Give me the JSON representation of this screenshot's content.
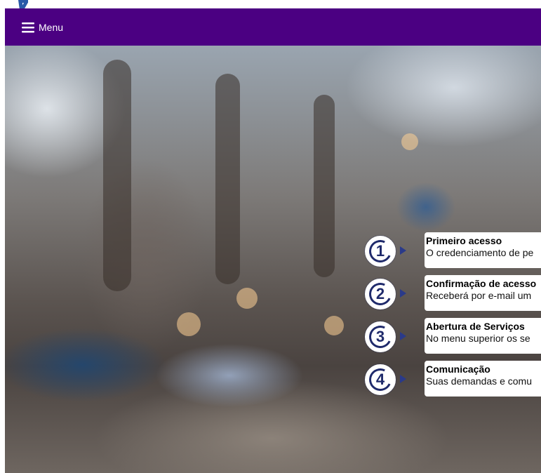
{
  "header": {
    "menu_label": "Menu",
    "background_color": "#4b0082",
    "menu_icon": "hamburger-icon"
  },
  "hero": {
    "image": "blurred-street-background"
  },
  "steps": [
    {
      "number": "1",
      "title": "Primeiro acesso",
      "text": "O credenciamento de pe"
    },
    {
      "number": "2",
      "title": "Confirmação de acesso",
      "text": "Receberá por e-mail um"
    },
    {
      "number": "3",
      "title": "Abertura de Serviços",
      "text": "No menu superior os se"
    },
    {
      "number": "4",
      "title": "Comunicação",
      "text": "Suas demandas e comu"
    }
  ],
  "colors": {
    "step_accent": "#1f2a6b",
    "card_background": "#ffffff"
  }
}
